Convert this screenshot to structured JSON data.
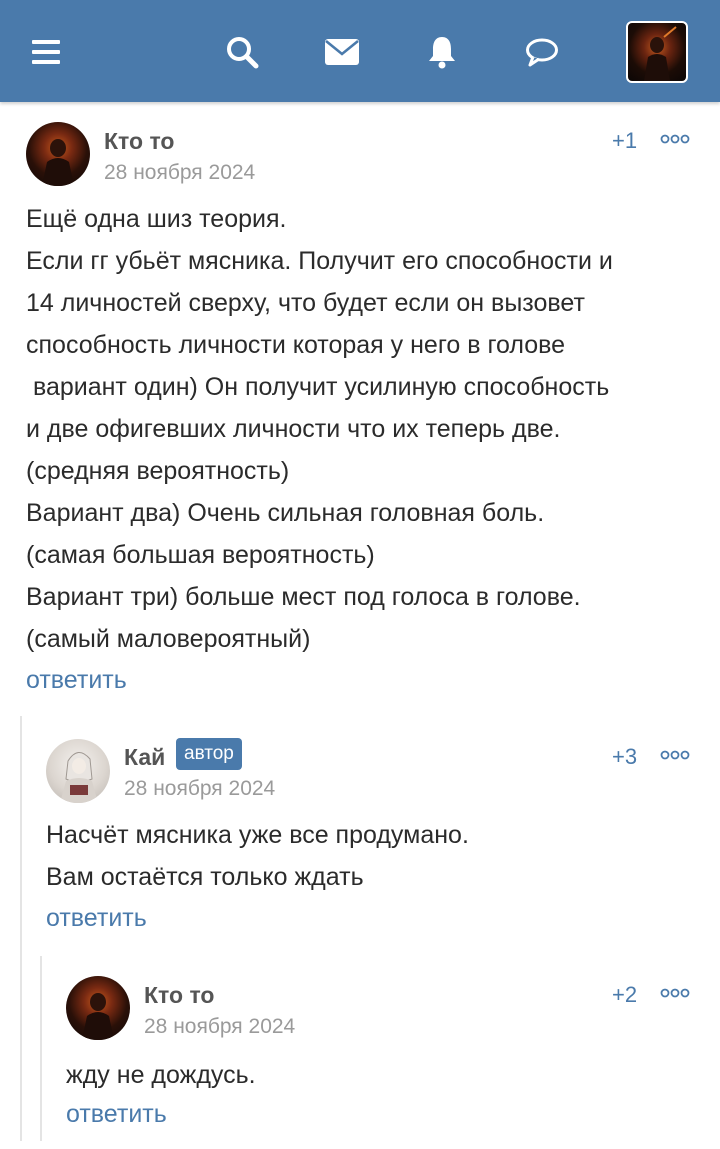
{
  "nav": {
    "icons": [
      "menu-icon",
      "search-icon",
      "mail-icon",
      "bell-icon",
      "chat-icon"
    ]
  },
  "colors": {
    "header": "#4a7aab",
    "accent": "#4a7aab",
    "date": "#9a9a9a"
  },
  "comments": [
    {
      "author": "Кто то",
      "date": "28 ноября 2024",
      "score": "+1",
      "lines": [
        "Ещё одна шиз теория.",
        "Если гг убьёт мясника. Получит его способности и",
        "14 личностей сверху, что будет если он вызовет",
        "способность личности которая у него в голове",
        " вариант один) Он получит усилиную способность",
        "и две офигевших личности что их теперь две.",
        "(средняя вероятность)",
        "Вариант два) Очень сильная головная боль.",
        "(самая большая вероятность)",
        "Вариант три) больше мест под голоса в голове.",
        "(самый маловероятный)"
      ],
      "reply_label": "ответить"
    },
    {
      "author": "Кай",
      "badge": "автор",
      "date": "28 ноября 2024",
      "score": "+3",
      "lines": [
        "Насчёт мясника уже все продумано.",
        "Вам остаётся только ждать"
      ],
      "reply_label": "ответить"
    },
    {
      "author": "Кто то",
      "date": "28 ноября 2024",
      "score": "+2",
      "lines": [
        "жду не дождусь."
      ],
      "reply_label": "ответить"
    }
  ]
}
